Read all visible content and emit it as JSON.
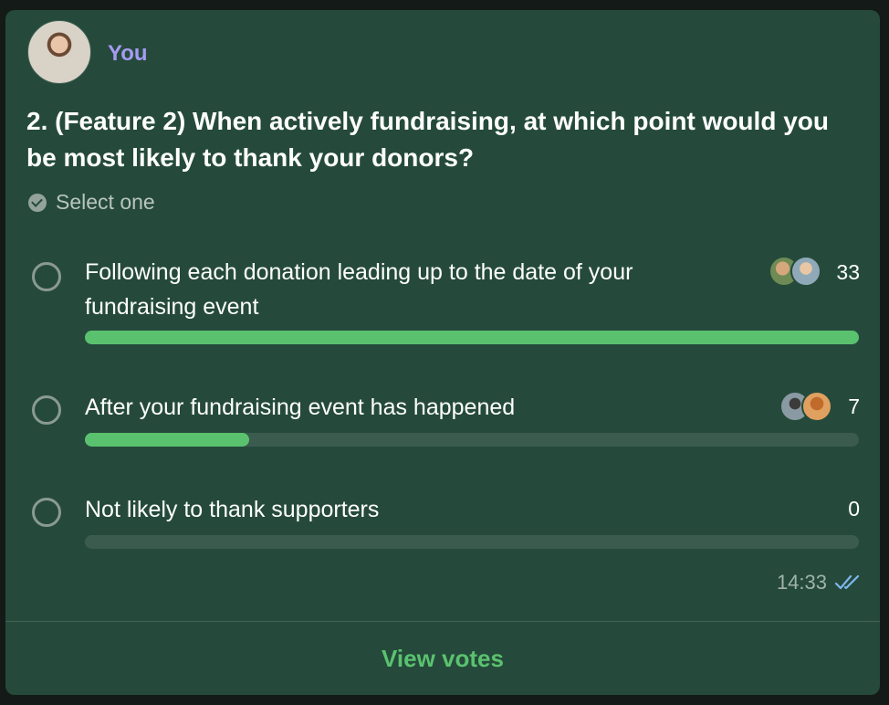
{
  "poll": {
    "author": "You",
    "question": "2. (Feature 2) When actively fundraising, at which point would you be most likely to thank your donors?",
    "instruction": "Select one",
    "options": [
      {
        "label": "Following each donation leading up to the date of your fundraising event",
        "count": "33",
        "share": 1.0
      },
      {
        "label": "After your fundraising event has happened",
        "count": "7",
        "share": 0.212
      },
      {
        "label": "Not likely to thank supporters",
        "count": "0",
        "share": 0
      }
    ],
    "time": "14:33",
    "view_votes": "View votes"
  },
  "colors": {
    "accent": "#5ac26f",
    "author": "#a69bf2",
    "card": "#254a3b",
    "read_receipt": "#7db7f0"
  }
}
